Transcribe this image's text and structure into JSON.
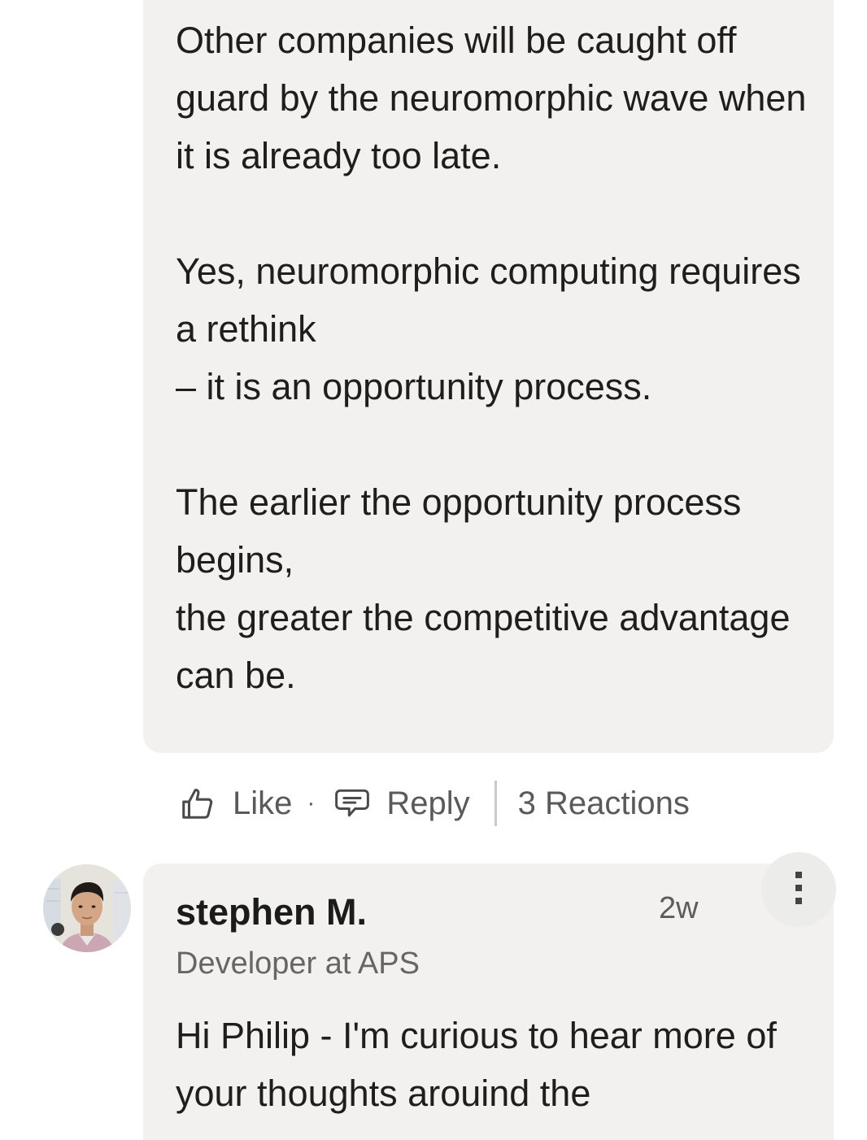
{
  "comment": {
    "body": "Other companies will be caught off guard by the neuromorphic wave when it is already too late.\n\nYes, neuromorphic computing requires a rethink\n– it is an opportunity process.\n\nThe earlier the opportunity process begins,\nthe greater the competitive advantage can be."
  },
  "actions": {
    "like_label": "Like",
    "separator": "·",
    "reply_label": "Reply",
    "reactions_label": "3 Reactions"
  },
  "reply": {
    "author_name": "stephen M.",
    "author_headline": "Developer at APS",
    "timestamp": "2w",
    "body": "Hi Philip - I'm curious to hear more of your thoughts arouind the"
  },
  "icons": {
    "like": "thumbs-up-icon",
    "reply": "speech-bubble-icon",
    "more": "vertical-ellipsis-icon"
  },
  "colors": {
    "bubble_background": "#f2f1ef",
    "primary_text": "#1e1e1e",
    "secondary_text": "#666666"
  }
}
